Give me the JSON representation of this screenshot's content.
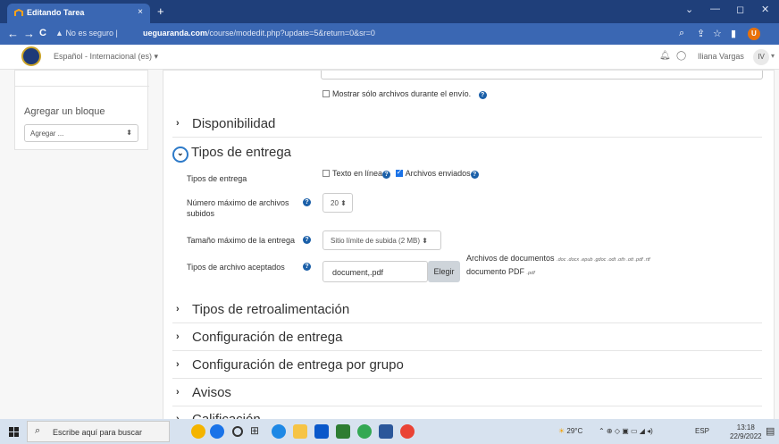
{
  "browser": {
    "tab_title": "Editando Tarea",
    "tab_close": "×",
    "new_tab": "+",
    "win_minimize": "—",
    "win_maximize": "◻",
    "win_close": "✕",
    "win_dropdown": "⌄",
    "security_label": "No es seguro",
    "url_host": "ueguaranda.com",
    "url_path": "/course/modedit.php?update=5&return=0&sr=0",
    "back": "←",
    "forward": "→",
    "reload": "C",
    "warn_icon": "▲",
    "profile_initial": "U",
    "accent": "#3a67b3"
  },
  "navbar": {
    "language": "Español - Internacional (es) ▾",
    "user_name": "Iliana Vargas",
    "user_initials": "IV",
    "user_menu": "▾"
  },
  "block": {
    "title": "Agregar un bloque",
    "select_value": "Agregar ...",
    "select_arrow": "⬍"
  },
  "form": {
    "show_only_files": "Mostrar sólo archivos durante el envío.",
    "help_glyph": "?",
    "sections_before": [
      {
        "title": "Disponibilidad"
      }
    ],
    "open_section": {
      "title": "Tipos de entrega",
      "chevron": "⌄"
    },
    "submission_types_label": "Tipos de entrega",
    "online_text": "Texto en línea",
    "online_text_checked": false,
    "file_submissions": "Archivos enviados",
    "file_submissions_checked": true,
    "max_files_label": "Número máximo de archivos subidos",
    "max_files_value": "20 ⬍",
    "max_size_label": "Tamaño máximo de la entrega",
    "max_size_value": "Sitio límite de subida (2 MB) ⬍",
    "accepted_types_label": "Tipos de archivo aceptados",
    "accepted_types_value": "document,.pdf",
    "choose_button": "Elegir",
    "doc_types_title": "Archivos de documentos",
    "doc_types_ext": ".doc .docx .epub .gdoc .odt .oth .ott .pdf .rtf",
    "pdf_title": "documento PDF",
    "pdf_ext": ".pdf",
    "chevron": "›",
    "sections_after": [
      {
        "title": "Tipos de retroalimentación"
      },
      {
        "title": "Configuración de entrega"
      },
      {
        "title": "Configuración de entrega por grupo"
      },
      {
        "title": "Avisos"
      },
      {
        "title": "Calificación"
      }
    ]
  },
  "taskbar": {
    "search_placeholder": "Escribe aquí para buscar",
    "search_icon": "⌕",
    "weather": "29°C",
    "language": "ESP",
    "time": "13:18",
    "date": "22/9/2022"
  }
}
